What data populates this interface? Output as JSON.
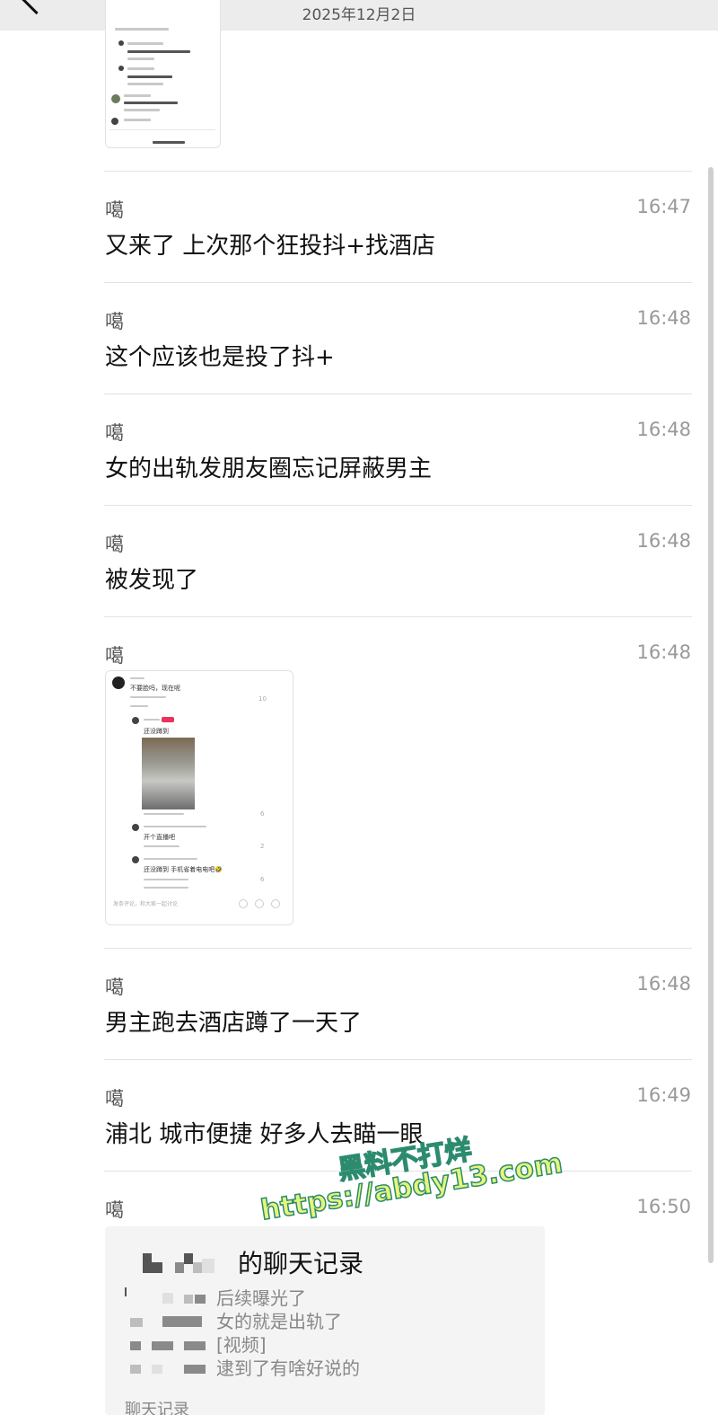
{
  "header": {
    "date": "2025年12月2日"
  },
  "messages": [
    {
      "sender": "噶",
      "time": "16:47",
      "text": "又来了 上次那个狂投抖+找酒店"
    },
    {
      "sender": "噶",
      "time": "16:48",
      "text": "这个应该也是投了抖+"
    },
    {
      "sender": "噶",
      "time": "16:48",
      "text": "女的出轨发朋友圈忘记屏蔽男主"
    },
    {
      "sender": "噶",
      "time": "16:48",
      "text": "被发现了"
    },
    {
      "sender": "噶",
      "time": "16:48"
    },
    {
      "sender": "噶",
      "time": "16:48",
      "text": "男主跑去酒店蹲了一天了"
    },
    {
      "sender": "噶",
      "time": "16:49",
      "text": "浦北 城市便捷 好多人去瞄一眼"
    },
    {
      "sender": "噶",
      "time": "16:50"
    }
  ],
  "screenshot_thumb": {
    "comment_1": "不要脸吗，现在呢",
    "likes_1": "10",
    "reply_1": "还没蹲到",
    "likes_2": "6",
    "reply_2": "开个直播吧",
    "likes_3": "2",
    "reply_3": "还没蹲到  手机省着电电吧🤣",
    "likes_4": "6",
    "input_placeholder": "发条评论，和大家一起讨论"
  },
  "chat_record": {
    "title": "的聊天记录",
    "lines": [
      "后续曝光了",
      "女的就是出轨了",
      "[视频]",
      "逮到了有啥好说的"
    ],
    "footer": "聊天记录"
  },
  "watermark": {
    "line1": "黑料不打烊",
    "line2": "https://abdy13.com"
  }
}
